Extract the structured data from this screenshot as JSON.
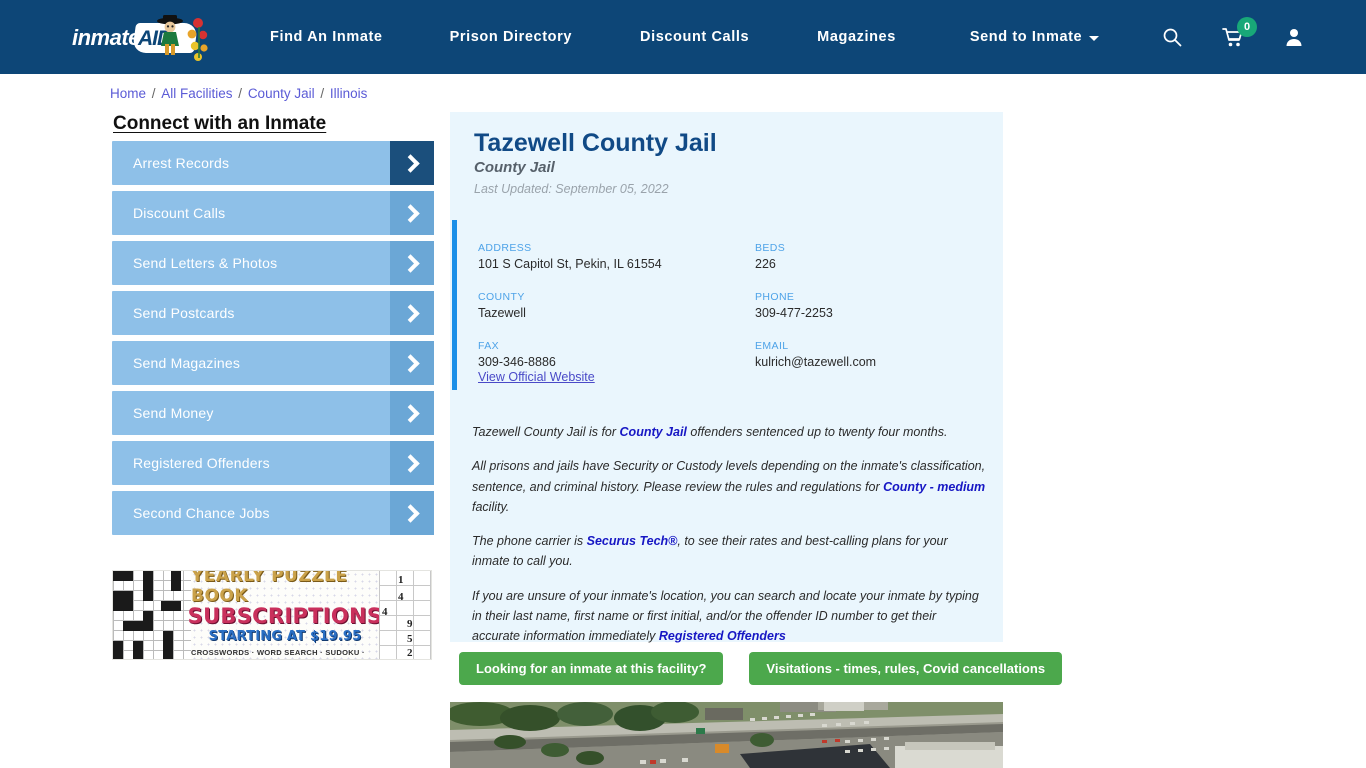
{
  "header": {
    "logo": {
      "text": "inmate",
      "accent": "AID",
      "icon": "inmateaid-logo"
    },
    "nav": [
      {
        "label": "Find An Inmate",
        "dropdown": false
      },
      {
        "label": "Prison Directory",
        "dropdown": false
      },
      {
        "label": "Discount Calls",
        "dropdown": false
      },
      {
        "label": "Magazines",
        "dropdown": false
      },
      {
        "label": "Send to Inmate",
        "dropdown": true
      }
    ],
    "icons": {
      "search": "search-icon",
      "cart": "shopping-cart-icon",
      "cart_count": "0",
      "account": "user-account-icon"
    },
    "bg_color": "#0d4677",
    "badge_color": "#18a878"
  },
  "breadcrumb": {
    "items": [
      "Home",
      "All Facilities",
      "County Jail",
      "Illinois"
    ],
    "separator": "/"
  },
  "sidebar": {
    "title": "Connect with an Inmate",
    "items": [
      {
        "label": "Arrest Records",
        "active": true
      },
      {
        "label": "Discount Calls",
        "active": false
      },
      {
        "label": "Send Letters & Photos",
        "active": false
      },
      {
        "label": "Send Postcards",
        "active": false
      },
      {
        "label": "Send Magazines",
        "active": false
      },
      {
        "label": "Send Money",
        "active": false
      },
      {
        "label": "Registered Offenders",
        "active": false
      },
      {
        "label": "Second Chance Jobs",
        "active": false
      }
    ],
    "button_color": "#8ec0e8",
    "arrow_color": "#6ba7d6",
    "arrow_active_color": "#1b4f7c"
  },
  "ad": {
    "line1": "YEARLY PUZZLE BOOK",
    "line2": "SUBSCRIPTIONS",
    "line3": "STARTING AT $19.95",
    "line4": "CROSSWORDS · WORD SEARCH · SUDOKU · BRAIN TEASERS",
    "sudoku_numbers": [
      "1",
      "4",
      "4",
      "9",
      "5",
      "2"
    ]
  },
  "facility": {
    "name": "Tazewell County Jail",
    "type": "County Jail",
    "last_updated": "Last Updated: September 05, 2022",
    "info": [
      {
        "key": "ADDRESS",
        "value": "101 S Capitol St, Pekin, IL 61554"
      },
      {
        "key": "BEDS",
        "value": "226"
      },
      {
        "key": "COUNTY",
        "value": "Tazewell"
      },
      {
        "key": "PHONE",
        "value": "309-477-2253"
      },
      {
        "key": "FAX",
        "value": "309-346-8886"
      },
      {
        "key": "EMAIL",
        "value": "kulrich@tazewell.com"
      }
    ],
    "official_website_label": "View Official Website",
    "accent_bar_color": "#1a8fe8",
    "panel_bg": "#eaf6fd"
  },
  "description": {
    "p1_a": "Tazewell County Jail is for ",
    "p1_link": "County Jail",
    "p1_b": " offenders sentenced up to twenty four months.",
    "p2_a": "All prisons and jails have Security or Custody levels depending on the inmate's classification, sentence, and criminal history. Please review the rules and regulations for ",
    "p2_link": "County - medium",
    "p2_b": " facility.",
    "p3_a": "The phone carrier is ",
    "p3_link": "Securus Tech®",
    "p3_b": ", to see their rates and best-calling plans for your inmate to call you.",
    "p4_a": "If you are unsure of your inmate's location, you can search and locate your inmate by typing in their last name, first name or first initial, and/or the offender ID number to get their accurate information immediately ",
    "p4_link": "Registered Offenders"
  },
  "actions": {
    "inmate_search_label": "Looking for an inmate at this facility?",
    "visitation_label": "Visitations - times, rules, Covid cancellations",
    "color": "#4ca84c"
  },
  "aerial_photo": {
    "alt": "aerial-view-of-facility-area"
  }
}
